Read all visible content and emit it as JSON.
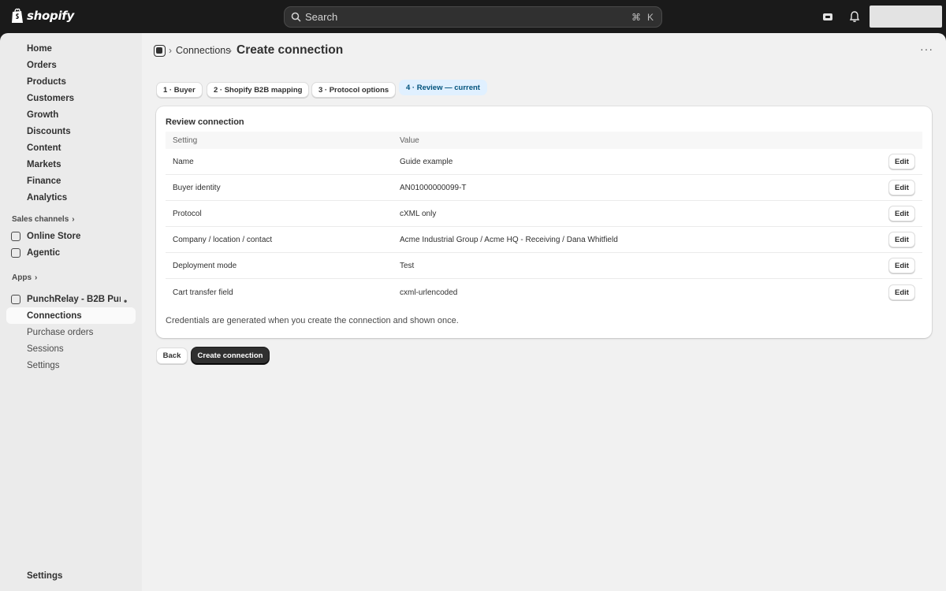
{
  "topbar": {
    "brand": "shopify",
    "search_placeholder": "Search",
    "shortcut_cmd": "⌘",
    "shortcut_key": "K"
  },
  "sidebar": {
    "items": [
      {
        "label": "Home"
      },
      {
        "label": "Orders"
      },
      {
        "label": "Products"
      },
      {
        "label": "Customers"
      },
      {
        "label": "Growth"
      },
      {
        "label": "Discounts"
      },
      {
        "label": "Content"
      },
      {
        "label": "Markets"
      },
      {
        "label": "Finance"
      },
      {
        "label": "Analytics"
      }
    ],
    "sales_channels_label": "Sales channels",
    "channels": [
      {
        "label": "Online Store"
      },
      {
        "label": "Agentic"
      }
    ],
    "apps_label": "Apps",
    "app_name": "PunchRelay - B2B Punc...",
    "app_subitems": [
      {
        "label": "Connections"
      },
      {
        "label": "Purchase orders"
      },
      {
        "label": "Sessions"
      },
      {
        "label": "Settings"
      }
    ],
    "footer_settings": "Settings"
  },
  "breadcrumb": {
    "parent": "Connections",
    "title": "Create connection"
  },
  "steps": [
    {
      "label": "1 · Buyer"
    },
    {
      "label": "2 · Shopify B2B mapping"
    },
    {
      "label": "3 · Protocol options"
    },
    {
      "label": "4 · Review — current"
    }
  ],
  "review": {
    "title": "Review connection",
    "columns": [
      "Setting",
      "Value"
    ],
    "edit_label": "Edit",
    "rows": [
      {
        "setting": "Name",
        "value": "Guide example"
      },
      {
        "setting": "Buyer identity",
        "value": "AN01000000099-T"
      },
      {
        "setting": "Protocol",
        "value": "cXML only"
      },
      {
        "setting": "Company / location / contact",
        "value": "Acme Industrial Group / Acme HQ - Receiving / Dana Whitfield"
      },
      {
        "setting": "Deployment mode",
        "value": "Test"
      },
      {
        "setting": "Cart transfer field",
        "value": "cxml-urlencoded"
      }
    ],
    "note": "Credentials are generated when you create the connection and shown once."
  },
  "actions": {
    "back": "Back",
    "create": "Create connection"
  },
  "colors": {
    "topbar_bg": "#1a1a1a",
    "sidebar_bg": "#ebebeb",
    "main_bg": "#f1f1f1",
    "current_step_bg": "#e0f0ff",
    "current_step_text": "#00527c",
    "primary_button": "#303030"
  }
}
